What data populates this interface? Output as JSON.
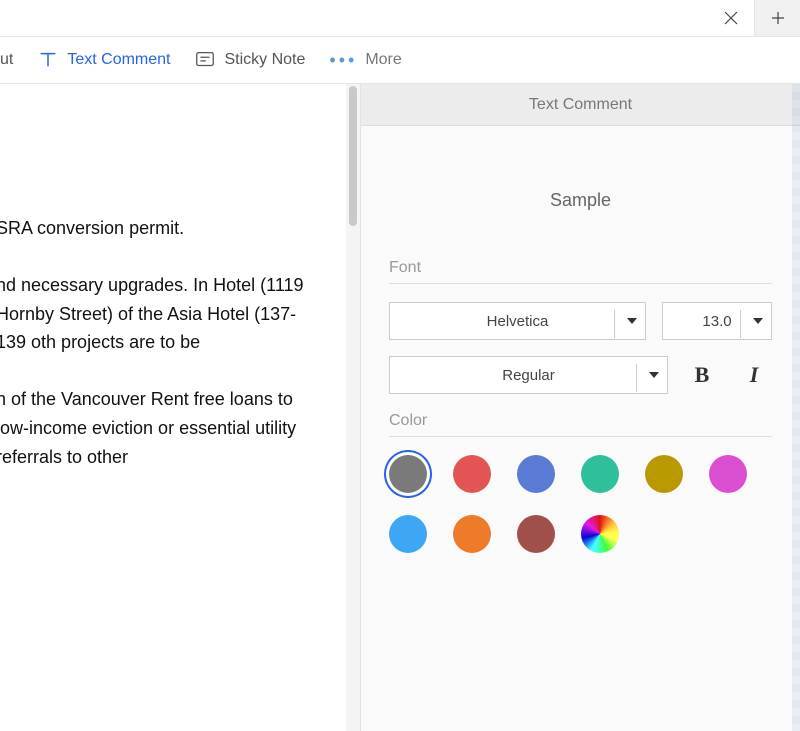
{
  "toolbar": {
    "truncated_item": "ut",
    "text_comment": "Text Comment",
    "sticky_note": "Sticky Note",
    "more": "More"
  },
  "document": {
    "p1": "SRA conversion permit.",
    "p2": "nd necessary upgrades. In Hotel (1119 Hornby Street) of the Asia Hotel (137-139 oth projects are to be",
    "p3": "n of the Vancouver Rent free loans to low-income eviction or essential utility referrals to other"
  },
  "panel": {
    "title": "Text Comment",
    "sample": "Sample",
    "font_label": "Font",
    "font_family": "Helvetica",
    "font_size": "13.0",
    "font_style": "Regular",
    "color_label": "Color",
    "swatches_row1": [
      {
        "name": "gray",
        "hex": "#7a7a7a",
        "selected": true
      },
      {
        "name": "red",
        "hex": "#e35555",
        "selected": false
      },
      {
        "name": "blue",
        "hex": "#5b7bd5",
        "selected": false
      },
      {
        "name": "teal",
        "hex": "#2fbf9a",
        "selected": false
      },
      {
        "name": "olive",
        "hex": "#b89a00",
        "selected": false
      },
      {
        "name": "magenta",
        "hex": "#d94fcf",
        "selected": false
      }
    ],
    "swatches_row2": [
      {
        "name": "skyblue",
        "hex": "#3fa6f5"
      },
      {
        "name": "orange",
        "hex": "#ef7a2a"
      },
      {
        "name": "brown",
        "hex": "#a0504a"
      },
      {
        "name": "custom",
        "hex": "rainbow"
      }
    ]
  }
}
